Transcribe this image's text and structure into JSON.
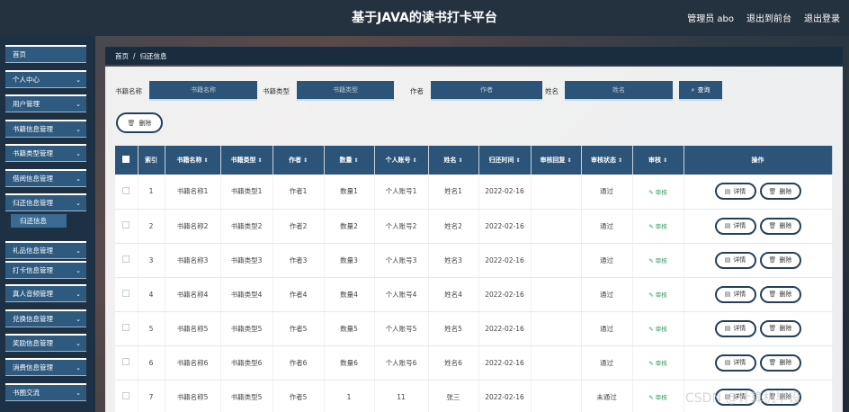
{
  "header": {
    "title": "基于JAVA的读书打卡平台",
    "user": "管理员 abo",
    "back_front": "退出到前台",
    "logout": "退出登录"
  },
  "sidebar": {
    "items": [
      {
        "label": "首页"
      },
      {
        "label": "个人中心"
      },
      {
        "label": "用户管理"
      },
      {
        "label": "书籍信息管理"
      },
      {
        "label": "书籍类型管理"
      },
      {
        "label": "借阅信息管理"
      },
      {
        "label": "归还信息管理"
      },
      {
        "label": "礼品信息管理"
      },
      {
        "label": "打卡信息管理"
      },
      {
        "label": "真人音频管理"
      },
      {
        "label": "兑换信息管理"
      },
      {
        "label": "奖励信息管理"
      },
      {
        "label": "消费信息管理"
      },
      {
        "label": "书圈交流"
      }
    ],
    "active_sub": "归还信息"
  },
  "breadcrumb": {
    "home": "首页",
    "sep": "/",
    "current": "归还信息"
  },
  "search": {
    "book_name_label": "书籍名称",
    "book_name_placeholder": "书籍名称",
    "book_type_label": "书籍类型",
    "book_type_placeholder": "书籍类型",
    "author_label": "作者",
    "author_placeholder": "作者",
    "name_label": "姓名",
    "name_placeholder": "姓名",
    "query": "查询"
  },
  "toolbar": {
    "delete": "删除"
  },
  "table": {
    "headers": [
      "索引",
      "书籍名称",
      "书籍类型",
      "作者",
      "数量",
      "个人账号",
      "姓名",
      "归还时间",
      "审核回复",
      "审核状态",
      "审核",
      "操作"
    ],
    "audit_label": "审核",
    "detail_label": "详情",
    "delete_label": "删除",
    "rows": [
      {
        "idx": "1",
        "book": "书籍名称1",
        "type": "书籍类型1",
        "author": "作者1",
        "qty": "数量1",
        "account": "个人账号1",
        "name": "姓名1",
        "time": "2022-02-16",
        "reply": "",
        "status": "通过"
      },
      {
        "idx": "2",
        "book": "书籍名称2",
        "type": "书籍类型2",
        "author": "作者2",
        "qty": "数量2",
        "account": "个人账号2",
        "name": "姓名2",
        "time": "2022-02-16",
        "reply": "",
        "status": "通过"
      },
      {
        "idx": "3",
        "book": "书籍名称3",
        "type": "书籍类型3",
        "author": "作者3",
        "qty": "数量3",
        "account": "个人账号3",
        "name": "姓名3",
        "time": "2022-02-16",
        "reply": "",
        "status": "通过"
      },
      {
        "idx": "4",
        "book": "书籍名称4",
        "type": "书籍类型4",
        "author": "作者4",
        "qty": "数量4",
        "account": "个人账号4",
        "name": "姓名4",
        "time": "2022-02-16",
        "reply": "",
        "status": "通过"
      },
      {
        "idx": "5",
        "book": "书籍名称5",
        "type": "书籍类型5",
        "author": "作者5",
        "qty": "数量5",
        "account": "个人账号5",
        "name": "姓名5",
        "time": "2022-02-16",
        "reply": "",
        "status": "通过"
      },
      {
        "idx": "6",
        "book": "书籍名称6",
        "type": "书籍类型6",
        "author": "作者6",
        "qty": "数量6",
        "account": "个人账号6",
        "name": "姓名6",
        "time": "2022-02-16",
        "reply": "",
        "status": "通过"
      },
      {
        "idx": "7",
        "book": "书籍名称5",
        "type": "书籍类型5",
        "author": "作者5",
        "qty": "1",
        "account": "11",
        "name": "张三",
        "time": "2022-02-16",
        "reply": "",
        "status": "未通过"
      }
    ]
  },
  "watermark": "CSDN @计算机毕设"
}
